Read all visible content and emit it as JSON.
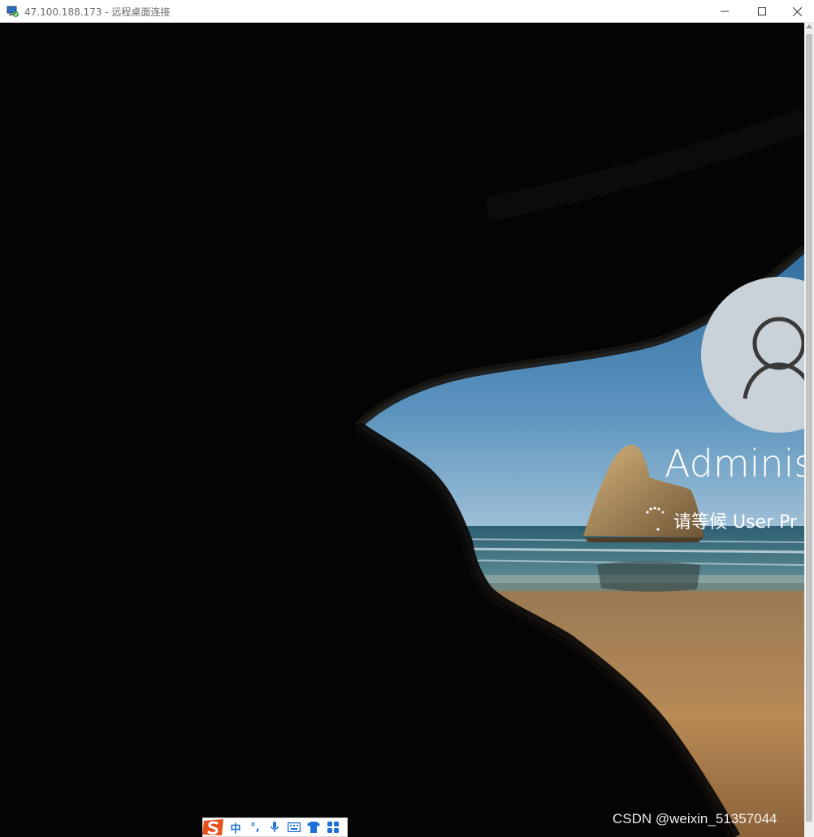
{
  "window": {
    "title": "47.100.188.173 - 远程桌面连接"
  },
  "login": {
    "user_name": "Administ",
    "status": "请等候 User Pr"
  },
  "ime": {
    "mode_label": "中",
    "punct_label": "°,"
  },
  "watermark": "CSDN @weixin_51357044",
  "colors": {
    "sky": "#3f7fb0",
    "sand": "#b98a55",
    "cave": "#050505",
    "ime_accent": "#1a6fd9"
  }
}
